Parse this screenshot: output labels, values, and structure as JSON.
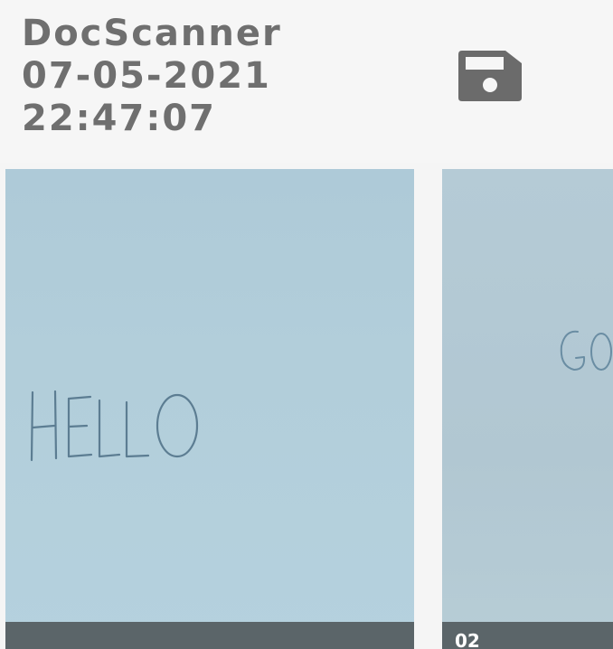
{
  "header": {
    "app_name": "DocScanner",
    "date": "07-05-2021",
    "time": "22:47:07",
    "save_icon": "floppy-disk-icon"
  },
  "pages": [
    {
      "page_number": "",
      "handwriting": "HELLO"
    },
    {
      "page_number": "02",
      "handwriting": "GO"
    }
  ],
  "colors": {
    "title": "#6f6f6f",
    "icon": "#6b6b6b",
    "thumbnail_footer": "#5b6569",
    "paper": "#b2ceda"
  }
}
